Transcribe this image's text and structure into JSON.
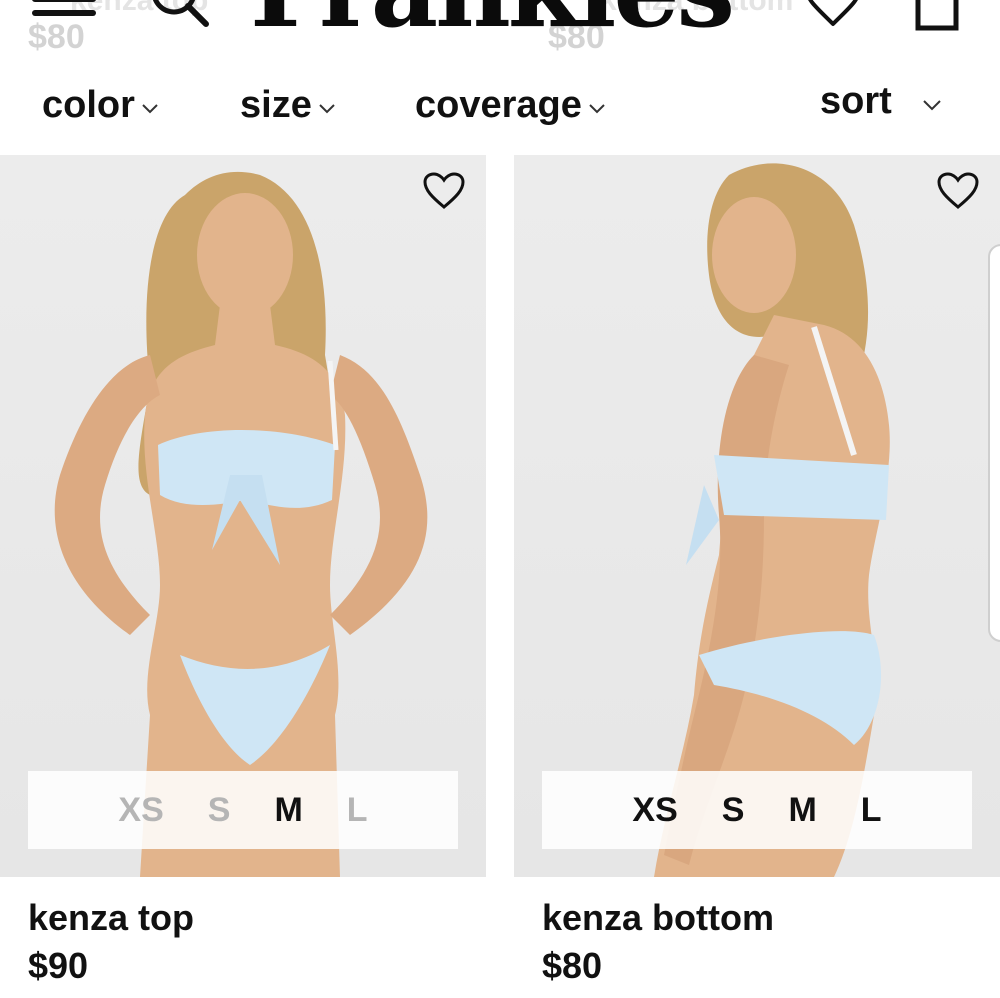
{
  "header": {
    "logo_text": "Frankies",
    "ghost_left_price": "$80",
    "ghost_left_name": "kenza top",
    "ghost_right_price": "$80",
    "ghost_right_name": "kenza bottom"
  },
  "filters": [
    {
      "label": "color"
    },
    {
      "label": "size"
    },
    {
      "label": "coverage"
    },
    {
      "label": "sort"
    }
  ],
  "products": [
    {
      "name": "kenza top",
      "price": "$90",
      "sizes": [
        {
          "label": "XS",
          "available": false
        },
        {
          "label": "S",
          "available": false
        },
        {
          "label": "M",
          "available": true
        },
        {
          "label": "L",
          "available": false
        }
      ]
    },
    {
      "name": "kenza bottom",
      "price": "$80",
      "sizes": [
        {
          "label": "XS",
          "available": true
        },
        {
          "label": "S",
          "available": true
        },
        {
          "label": "M",
          "available": true
        },
        {
          "label": "L",
          "available": true
        }
      ]
    }
  ],
  "colors": {
    "swimwear": "#cfe6f5",
    "skin": "#e2b48c",
    "hair": "#caa46a"
  }
}
